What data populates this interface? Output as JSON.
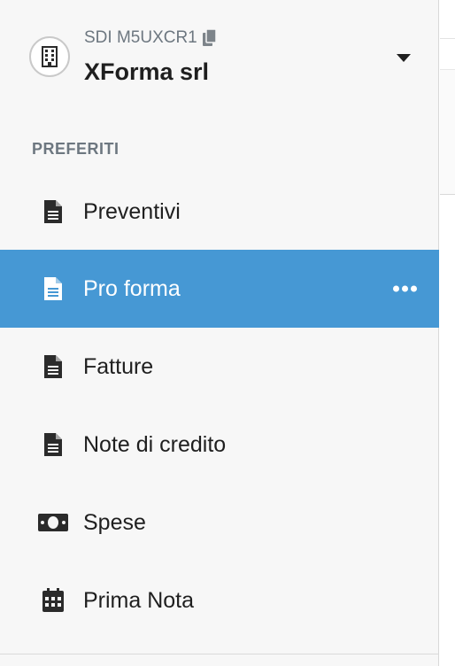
{
  "company": {
    "sdi_label": "SDI M5UXCR1",
    "name": "XForma srl"
  },
  "nav": {
    "section_title": "PREFERITI",
    "items": [
      {
        "label": "Preventivi",
        "icon": "document-icon",
        "active": false
      },
      {
        "label": "Pro forma",
        "icon": "document-icon",
        "active": true
      },
      {
        "label": "Fatture",
        "icon": "document-icon",
        "active": false
      },
      {
        "label": "Note di credito",
        "icon": "document-icon",
        "active": false
      },
      {
        "label": "Spese",
        "icon": "money-bill-icon",
        "active": false
      },
      {
        "label": "Prima Nota",
        "icon": "calendar-icon",
        "active": false
      }
    ]
  },
  "colors": {
    "active_bg": "#4698d4",
    "sidebar_bg": "#f7f7f7",
    "muted_text": "#6d7780",
    "text": "#1f1f1f"
  }
}
